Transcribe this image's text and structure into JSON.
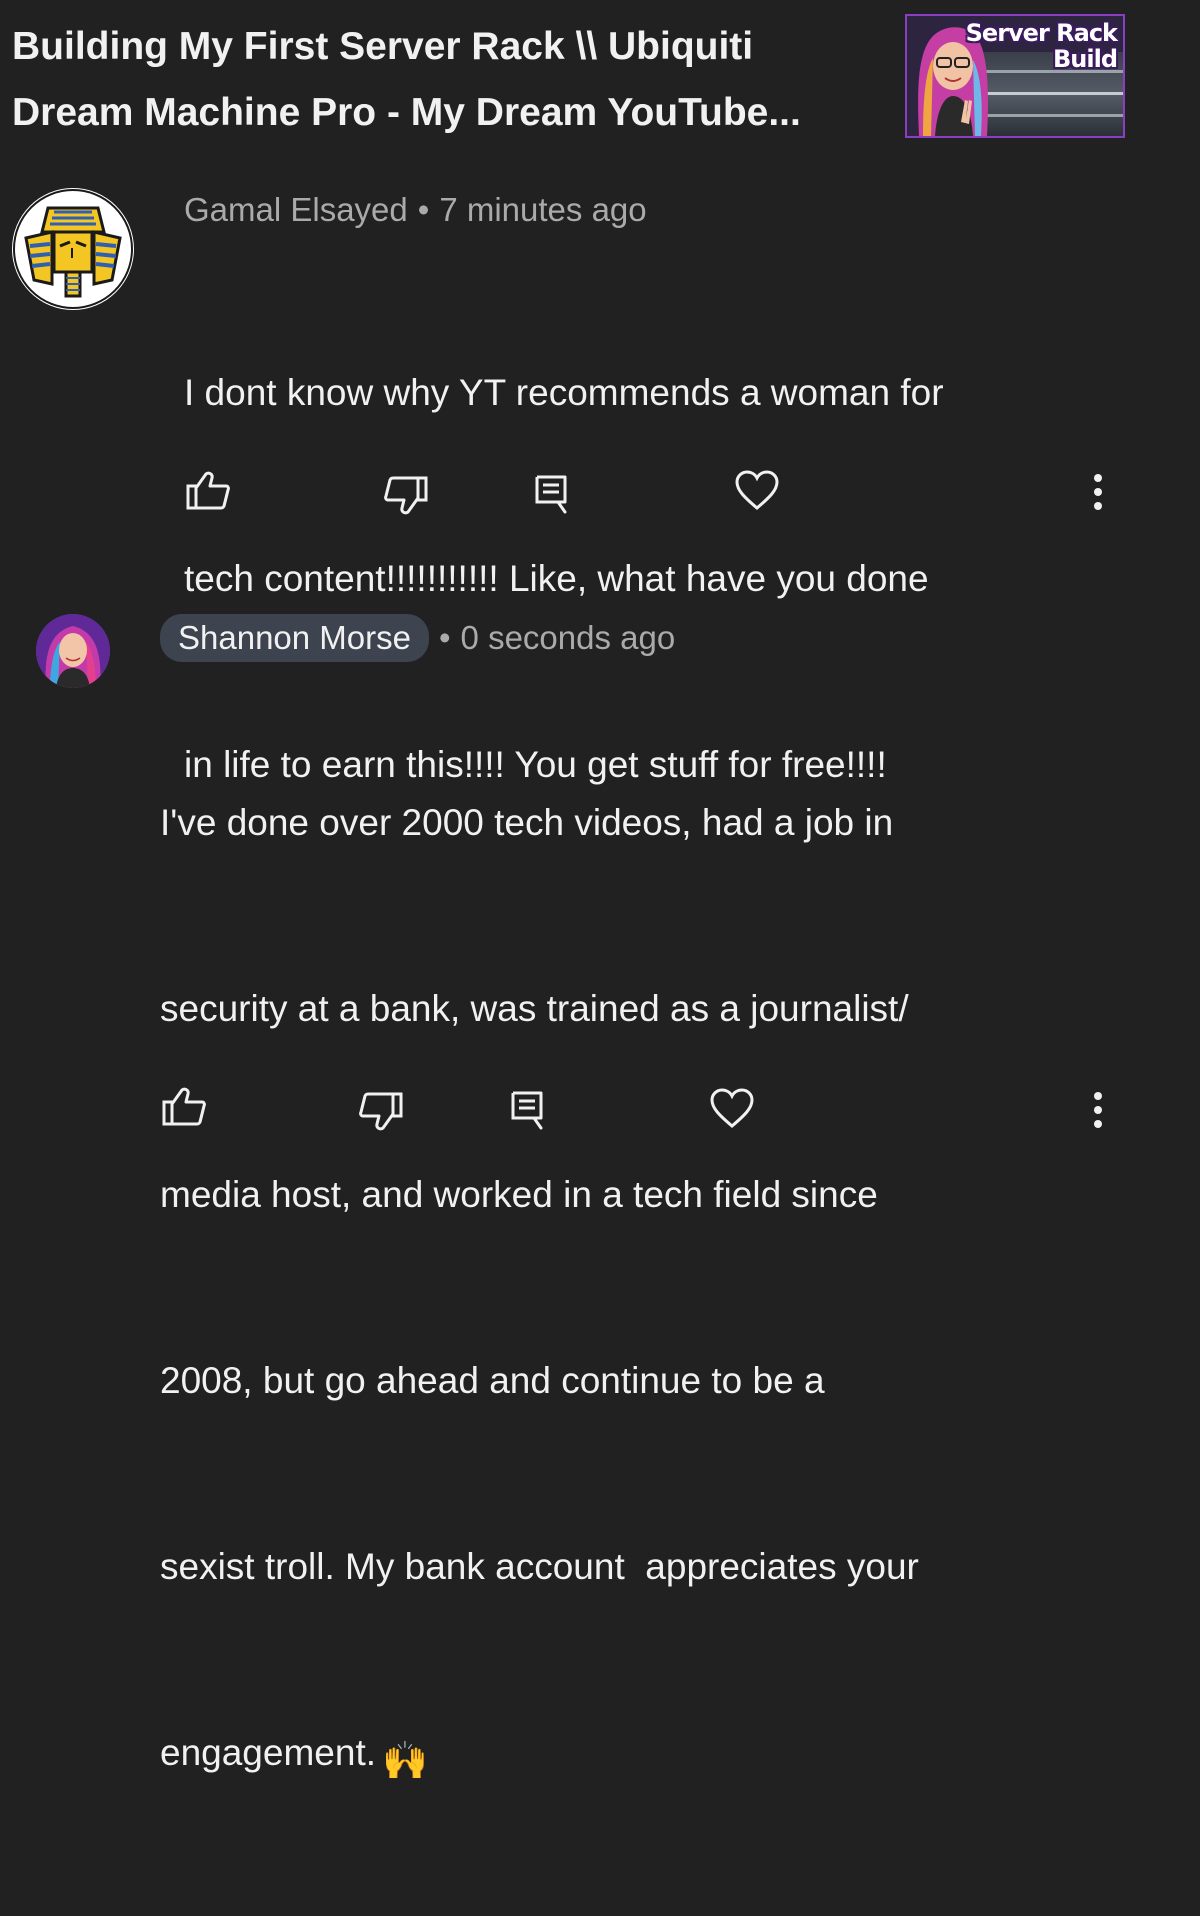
{
  "video": {
    "title_line1": "Building My First Server Rack \\\\ Ubiquiti",
    "title_line2": "Dream Machine Pro - My Dream YouTube...",
    "thumbnail_text_line1": "Server Rack",
    "thumbnail_text_line2": "Build"
  },
  "comments": [
    {
      "author": "Gamal Elsayed",
      "separator": "•",
      "time": "7 minutes ago",
      "text_lines": [
        "I dont know why YT recommends a woman for",
        "tech content!!!!!!!!!!! Like, what have you done",
        "in life to earn this!!!! You get stuff for free!!!!"
      ],
      "avatar_icon": "pharaoh-avatar-icon"
    },
    {
      "author": "Shannon Morse",
      "separator": "•",
      "time": "0 seconds ago",
      "text_lines": [
        "I've done over 2000 tech videos, had a job in",
        "security at a bank, was trained as a journalist/",
        "media host, and worked in a tech field since",
        "2008, but go ahead and continue to be a",
        "sexist troll. My bank account  appreciates your",
        "engagement."
      ],
      "emoji": "🙌",
      "avatar_icon": "creator-avatar-icon"
    }
  ],
  "actions": {
    "icons": [
      "thumbs-up-icon",
      "thumbs-down-icon",
      "reply-icon",
      "heart-icon",
      "more-vert-icon"
    ]
  },
  "colors": {
    "background": "#212121",
    "text_primary": "#f1f1f1",
    "text_secondary": "#aaaaaa",
    "author_chip": "#3d4450",
    "thumbnail_border": "#8a3fc2"
  }
}
